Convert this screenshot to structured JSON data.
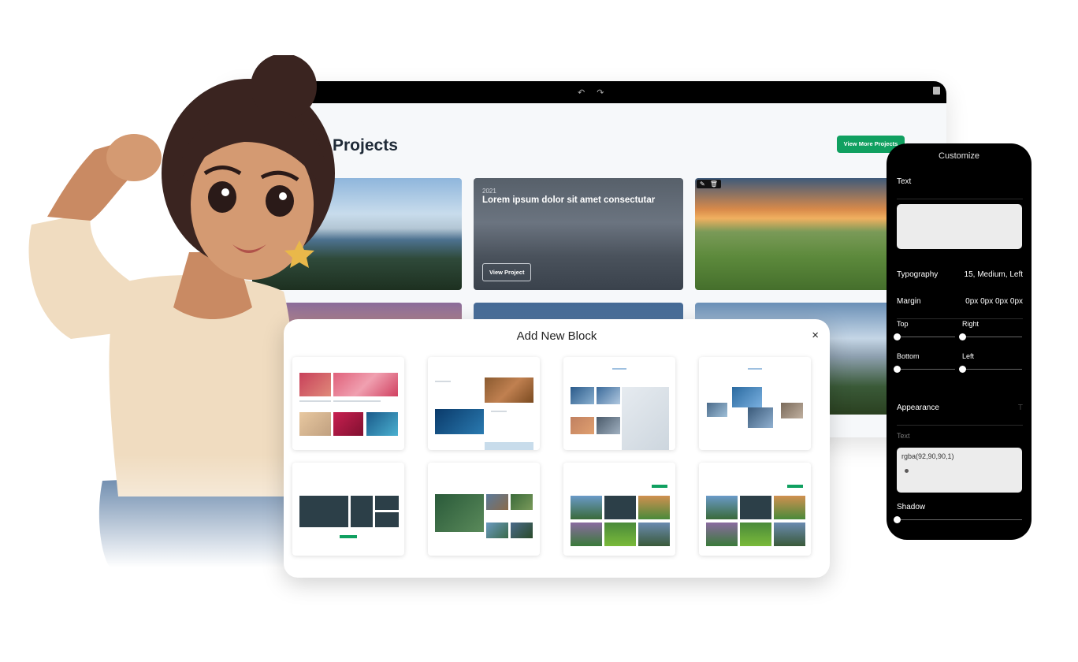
{
  "editor": {
    "undo_redo": "↶ ↷",
    "page_title": "Projects",
    "view_more_label": "View More Projects",
    "featured_card": {
      "year": "2021",
      "heading": "Lorem ipsum dolor sit amet consectutar",
      "button_label": "View Project"
    },
    "card_tools": {
      "edit": "✎",
      "delete": "🗑"
    }
  },
  "modal": {
    "title": "Add New Block",
    "close": "×"
  },
  "panel": {
    "title": "Customize",
    "text_label": "Text",
    "typography_label": "Typography",
    "typography_value": "15, Medium, Left",
    "margin_label": "Margin",
    "margin_value": "0px 0px 0px 0px",
    "top_label": "Top",
    "right_label": "Right",
    "bottom_label": "Bottom",
    "left_label": "Left",
    "appearance_label": "Appearance",
    "appearance_icon": "T",
    "text_sublabel": "Text",
    "color_value": "rgba(92,90,90,1)",
    "shadow_label": "Shadow"
  },
  "colors": {
    "accent_green": "#10a060",
    "panel_bg": "#000000",
    "editor_bg": "#f6f8fa"
  }
}
